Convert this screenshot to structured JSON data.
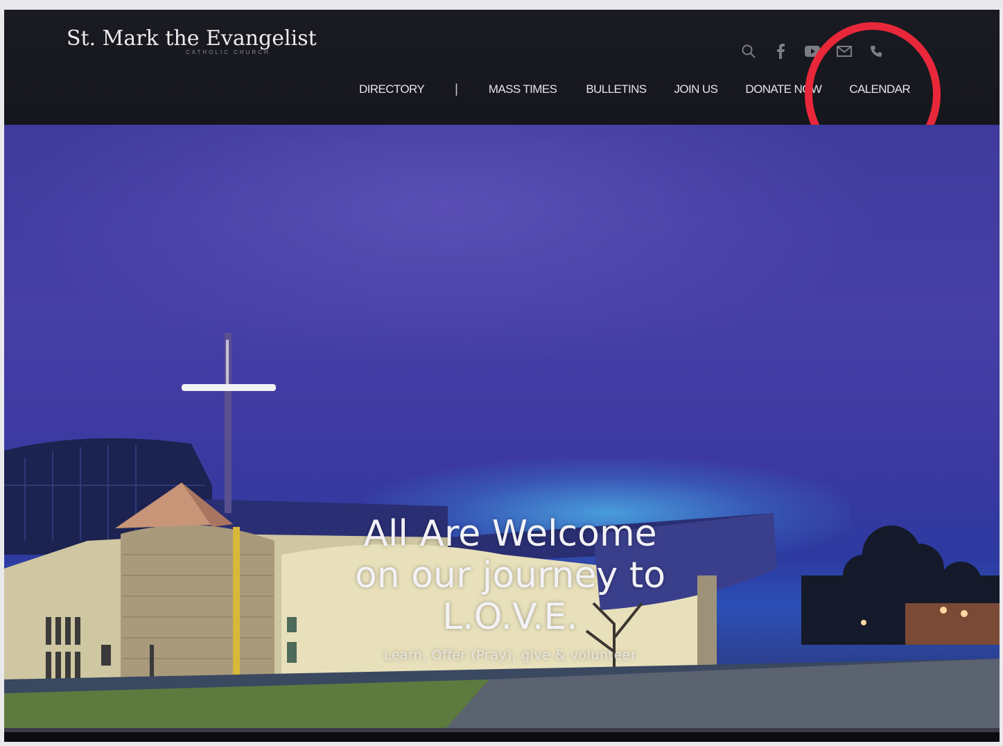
{
  "site": {
    "title": "St. Mark the Evangelist",
    "subtitle": "CATHOLIC CHURCH"
  },
  "header_icons": [
    {
      "name": "search-icon"
    },
    {
      "name": "facebook-icon"
    },
    {
      "name": "youtube-icon"
    },
    {
      "name": "email-icon"
    },
    {
      "name": "phone-icon"
    }
  ],
  "nav": {
    "directory": "DIRECTORY",
    "separator": "|",
    "mass_times": "MASS TIMES",
    "bulletins": "BULLETINS",
    "join_us": "JOIN US",
    "donate_now": "DONATE NOW",
    "calendar": "CALENDAR"
  },
  "hero": {
    "headline_line1": "All Are Welcome",
    "headline_line2": "on our journey to",
    "headline_line3": "L.O.V.E.",
    "tagline": "Learn, Offer (Pray), give & volunteer"
  },
  "annotation": {
    "color": "#e8283a",
    "target": "CALENDAR"
  },
  "colors": {
    "header_bg": "#17171e",
    "hero_sky": "#463fa6",
    "nav_text": "#e4e4ea"
  }
}
